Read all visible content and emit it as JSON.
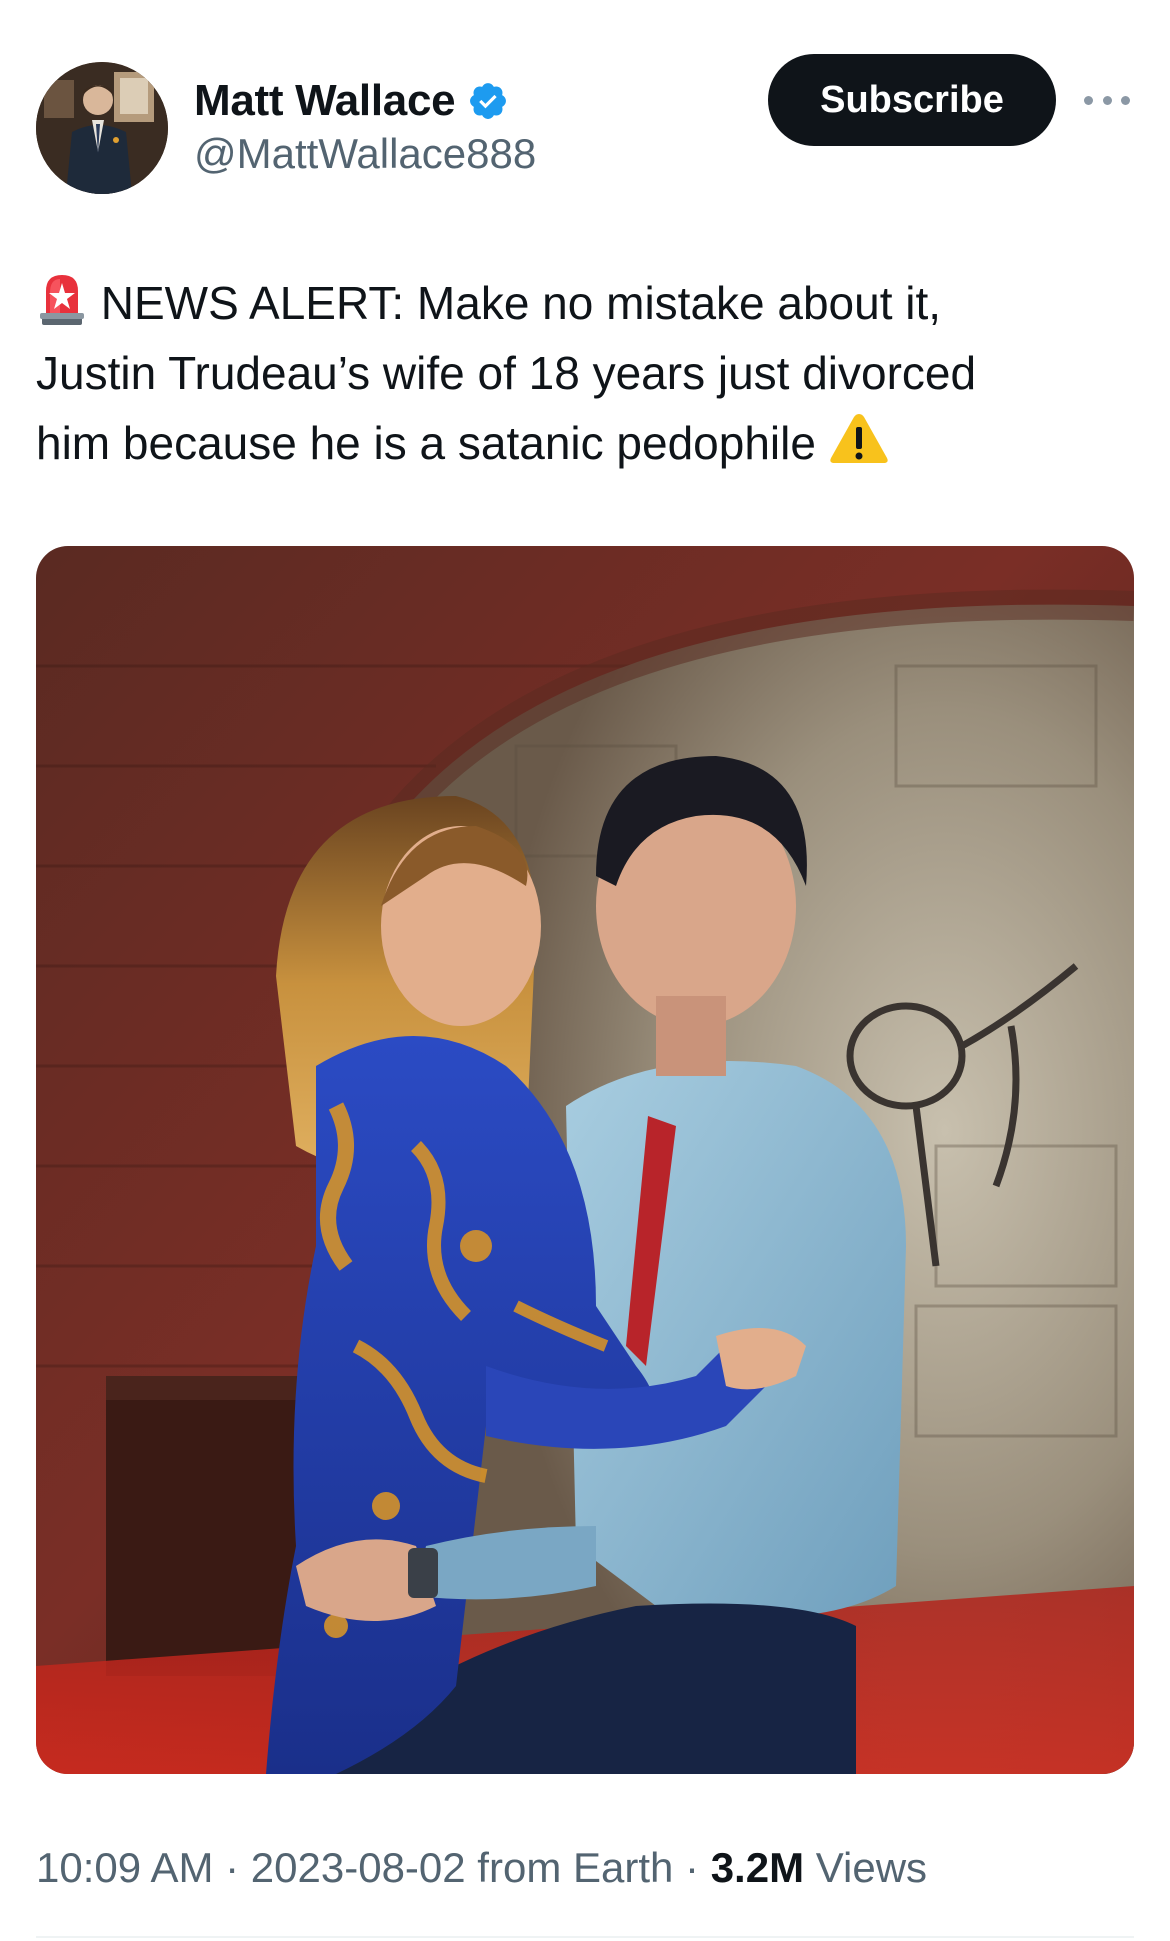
{
  "author": {
    "display_name": "Matt Wallace",
    "handle": "@MattWallace888",
    "verified": true,
    "verified_color": "#1d9bf0"
  },
  "actions": {
    "subscribe_label": "Subscribe",
    "more_icon": "more-horizontal-icon"
  },
  "tweet": {
    "lines": [
      "NEWS ALERT: Make no mistake about it,",
      "Justin Trudeau’s wife of 18 years just divorced",
      "him because he is a satanic pedophile"
    ],
    "leading_emoji": "rotating-light-icon",
    "trailing_emoji": "warning-icon"
  },
  "media": {
    "icon": "photo-image"
  },
  "meta": {
    "time": "10:09 AM",
    "sep1": " · ",
    "date": "2023-08-02",
    "source": " from Earth",
    "sep2": " · ",
    "views_count": "3.2M",
    "views_label": " Views"
  },
  "colors": {
    "text_primary": "#0f1419",
    "text_secondary": "#536471",
    "button_bg": "#0f1419"
  }
}
